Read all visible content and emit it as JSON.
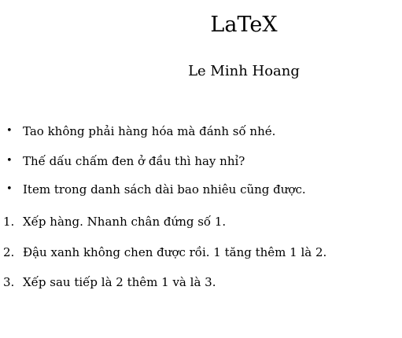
{
  "document": {
    "title": "LaTeX",
    "author": "Le Minh Hoang"
  },
  "bullet_list": [
    {
      "marker": "•",
      "text": "Tao không phải hàng hóa mà đánh số nhé."
    },
    {
      "marker": "•",
      "text": "Thế dấu chấm đen ở đầu thì hay nhỉ?"
    },
    {
      "marker": "•",
      "text": "Item trong danh sách dài bao nhiêu cũng được."
    }
  ],
  "numbered_list": [
    {
      "number": "1.",
      "text": "Xếp hàng. Nhanh chân đứng số 1."
    },
    {
      "number": "2.",
      "text": "Đậu xanh không chen được rồi. 1 tăng thêm 1 là 2."
    },
    {
      "number": "3.",
      "text": "Xếp sau tiếp là 2 thêm 1 và là 3."
    }
  ]
}
